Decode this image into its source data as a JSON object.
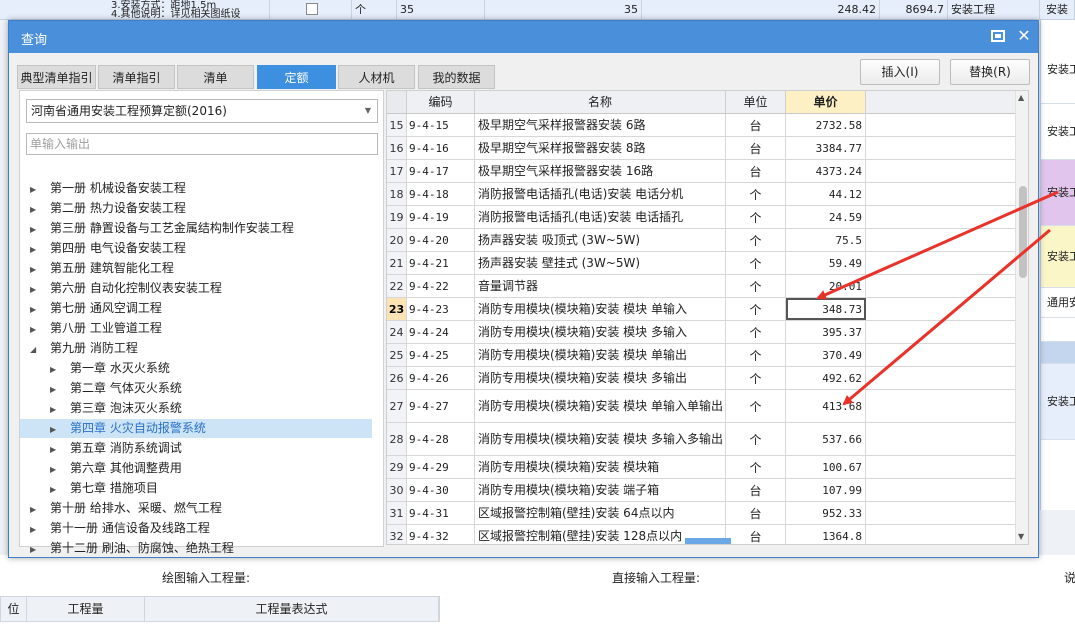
{
  "background": {
    "top_row": [
      "3.安装方式：距地1.5m",
      "4.其他说明：详见相关图纸设",
      "个",
      "35",
      "35",
      "248.42",
      "8694.7",
      "安装工程",
      "安装"
    ],
    "right_col": [
      "安装工",
      "安装工",
      "安装工",
      "安装工",
      "通用安",
      "安装工"
    ],
    "bottom": {
      "draw_qty_label": "绘图输入工程量:",
      "direct_qty_label": "直接输入工程量:",
      "right_cut_label": "说",
      "grid_headers": [
        "位",
        "工程量",
        "工程量表达式"
      ]
    }
  },
  "dialog": {
    "title": "查询",
    "tabs": [
      "典型清单指引",
      "清单指引",
      "清单",
      "定额",
      "人材机",
      "我的数据"
    ],
    "active_tab": "定额",
    "insert_button": "插入(I)",
    "replace_button": "替换(R)",
    "library": "河南省通用安装工程预算定额(2016)",
    "search_placeholder": "单输入输出",
    "tree": [
      {
        "label": "第一册 机械设备安装工程",
        "level": 0,
        "expanded": false
      },
      {
        "label": "第二册 热力设备安装工程",
        "level": 0,
        "expanded": false
      },
      {
        "label": "第三册 静置设备与工艺金属结构制作安装工程",
        "level": 0,
        "expanded": false
      },
      {
        "label": "第四册 电气设备安装工程",
        "level": 0,
        "expanded": false
      },
      {
        "label": "第五册 建筑智能化工程",
        "level": 0,
        "expanded": false
      },
      {
        "label": "第六册 自动化控制仪表安装工程",
        "level": 0,
        "expanded": false
      },
      {
        "label": "第七册 通风空调工程",
        "level": 0,
        "expanded": false
      },
      {
        "label": "第八册 工业管道工程",
        "level": 0,
        "expanded": false
      },
      {
        "label": "第九册 消防工程",
        "level": 0,
        "expanded": true
      },
      {
        "label": "第一章 水灭火系统",
        "level": 1,
        "expanded": false
      },
      {
        "label": "第二章 气体灭火系统",
        "level": 1,
        "expanded": false
      },
      {
        "label": "第三章 泡沫灭火系统",
        "level": 1,
        "expanded": false
      },
      {
        "label": "第四章 火灾自动报警系统",
        "level": 1,
        "expanded": false,
        "selected": true
      },
      {
        "label": "第五章 消防系统调试",
        "level": 1,
        "expanded": false
      },
      {
        "label": "第六章 其他调整费用",
        "level": 1,
        "expanded": false
      },
      {
        "label": "第七章 措施项目",
        "level": 1,
        "expanded": false
      },
      {
        "label": "第十册 给排水、采暖、燃气工程",
        "level": 0,
        "expanded": false
      },
      {
        "label": "第十一册 通信设备及线路工程",
        "level": 0,
        "expanded": false
      },
      {
        "label": "第十二册 刷油、防腐蚀、绝热工程",
        "level": 0,
        "expanded": false
      }
    ],
    "grid_headers": {
      "num": "",
      "code": "编码",
      "name": "名称",
      "unit": "单位",
      "price": "单价"
    },
    "rows": [
      {
        "num": "15",
        "code": "9-4-15",
        "name": "极早期空气采样报警器安装 6路",
        "unit": "台",
        "price": "2732.58"
      },
      {
        "num": "16",
        "code": "9-4-16",
        "name": "极早期空气采样报警器安装 8路",
        "unit": "台",
        "price": "3384.77"
      },
      {
        "num": "17",
        "code": "9-4-17",
        "name": "极早期空气采样报警器安装 16路",
        "unit": "台",
        "price": "4373.24"
      },
      {
        "num": "18",
        "code": "9-4-18",
        "name": "消防报警电话插孔(电话)安装 电话分机",
        "unit": "个",
        "price": "44.12"
      },
      {
        "num": "19",
        "code": "9-4-19",
        "name": "消防报警电话插孔(电话)安装 电话插孔",
        "unit": "个",
        "price": "24.59"
      },
      {
        "num": "20",
        "code": "9-4-20",
        "name": "扬声器安装 吸顶式 (3W~5W)",
        "unit": "个",
        "price": "75.5"
      },
      {
        "num": "21",
        "code": "9-4-21",
        "name": "扬声器安装 壁挂式 (3W~5W)",
        "unit": "个",
        "price": "59.49"
      },
      {
        "num": "22",
        "code": "9-4-22",
        "name": "音量调节器",
        "unit": "个",
        "price": "20.01"
      },
      {
        "num": "23",
        "code": "9-4-23",
        "name": "消防专用模块(模块箱)安装 模块 单输入",
        "unit": "个",
        "price": "348.73",
        "current": true
      },
      {
        "num": "24",
        "code": "9-4-24",
        "name": "消防专用模块(模块箱)安装 模块 多输入",
        "unit": "个",
        "price": "395.37"
      },
      {
        "num": "25",
        "code": "9-4-25",
        "name": "消防专用模块(模块箱)安装 模块 单输出",
        "unit": "个",
        "price": "370.49"
      },
      {
        "num": "26",
        "code": "9-4-26",
        "name": "消防专用模块(模块箱)安装 模块 多输出",
        "unit": "个",
        "price": "492.62"
      },
      {
        "num": "27",
        "code": "9-4-27",
        "name": "消防专用模块(模块箱)安装 模块 单输入单输出",
        "unit": "个",
        "price": "413.68",
        "tall": true
      },
      {
        "num": "28",
        "code": "9-4-28",
        "name": "消防专用模块(模块箱)安装 模块 多输入多输出",
        "unit": "个",
        "price": "537.66",
        "tall": true
      },
      {
        "num": "29",
        "code": "9-4-29",
        "name": "消防专用模块(模块箱)安装 模块箱",
        "unit": "个",
        "price": "100.67"
      },
      {
        "num": "30",
        "code": "9-4-30",
        "name": "消防专用模块(模块箱)安装 端子箱",
        "unit": "台",
        "price": "107.99"
      },
      {
        "num": "31",
        "code": "9-4-31",
        "name": "区域报警控制箱(壁挂)安装 64点以内",
        "unit": "台",
        "price": "952.33"
      },
      {
        "num": "32",
        "code": "9-4-32",
        "name": "区域报警控制箱(壁挂)安装 128点以内",
        "unit": "台",
        "price": "1364.8"
      }
    ],
    "annotation_color": "#e8322a",
    "accent_color": "#3d8fe0"
  }
}
